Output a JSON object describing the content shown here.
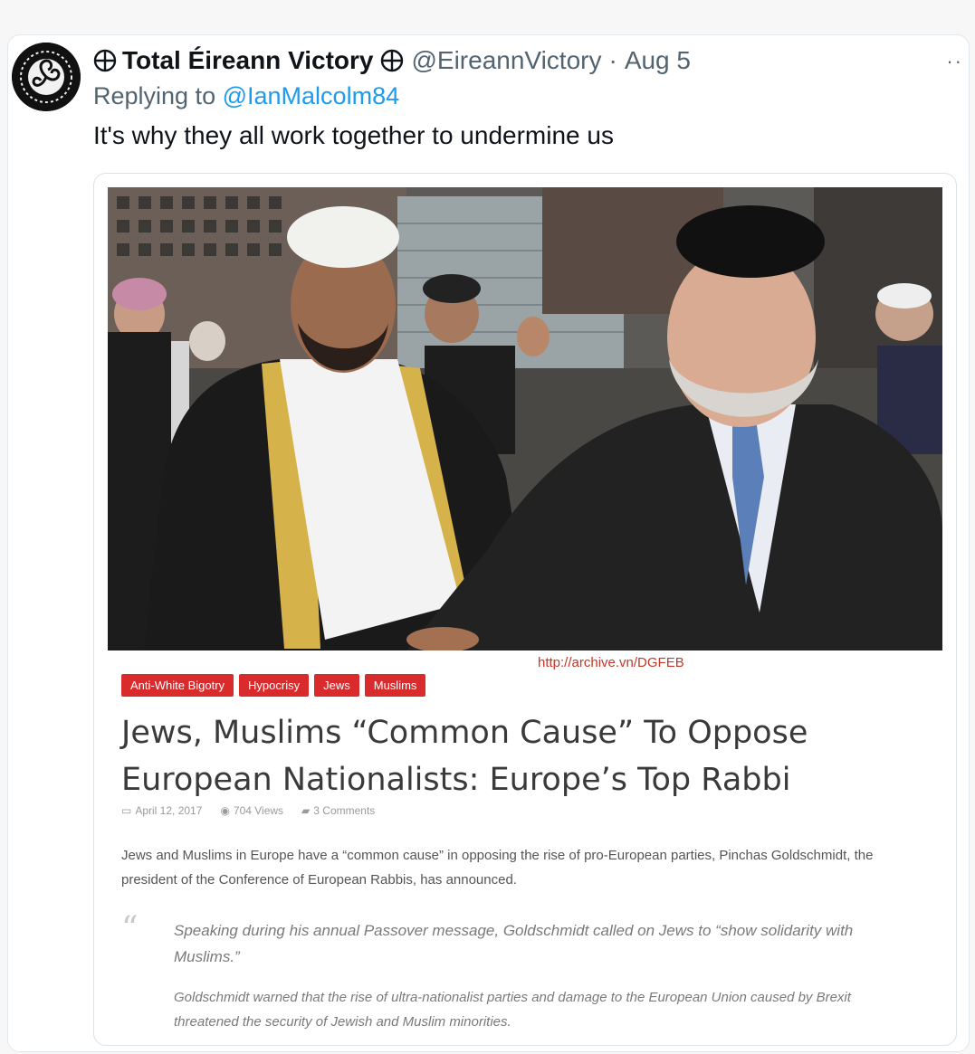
{
  "tweet": {
    "display_name": "Total Éireann Victory",
    "handle": "@EireannVictory",
    "separator": "·",
    "date": "Aug 5",
    "more_label": "··",
    "reply_prefix": "Replying to",
    "reply_to": "@IanMalcolm84",
    "text": "It's why they all work together to undermine us"
  },
  "card": {
    "url_watermark": "http://archive.vn/DGFEB",
    "tags": [
      "Anti-White Bigotry",
      "Hypocrisy",
      "Jews",
      "Muslims"
    ],
    "headline": "Jews, Muslims “Common Cause” To Oppose European Nationalists: Europe’s Top Rabbi",
    "meta": {
      "date": "April 12, 2017",
      "views": "704 Views",
      "comments": "3 Comments"
    },
    "lead": "Jews and Muslims in Europe have a “common cause” in opposing the rise of pro-European parties, Pinchas Goldschmidt, the president of the Conference of European Rabbis, has announced.",
    "quote_mark": "“",
    "quote_1": "Speaking during his annual Passover message, Goldschmidt called on Jews to “show solidarity with Muslims.”",
    "quote_2": "Goldschmidt warned that the rise of ultra-nationalist parties and damage to the European Union caused by Brexit threatened the security of Jewish and Muslim minorities."
  },
  "icons": {
    "globe": "globe-icon",
    "calendar": "calendar-icon",
    "eye": "eye-icon",
    "comment": "comment-icon"
  },
  "colors": {
    "link": "#1d9bf0",
    "tag_bg": "#d92b2b",
    "watermark": "#c0392b"
  }
}
